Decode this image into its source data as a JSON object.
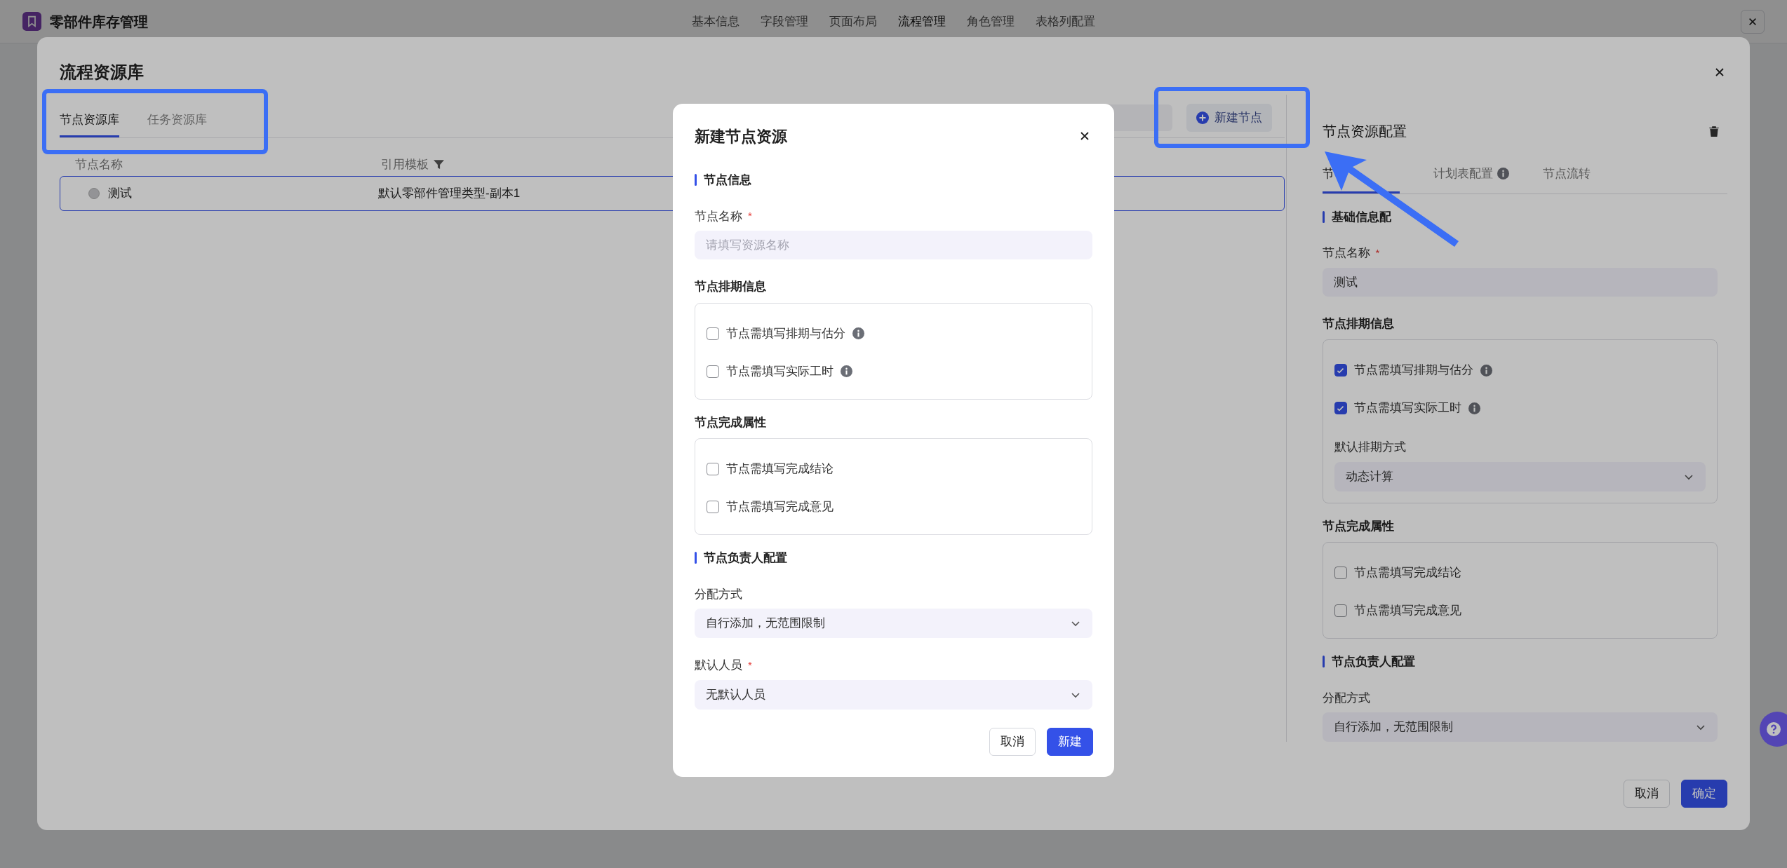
{
  "app": {
    "title": "零部件库存管理",
    "nav": [
      {
        "label": "基本信息",
        "selected": false
      },
      {
        "label": "字段管理",
        "selected": false
      },
      {
        "label": "页面布局",
        "selected": false
      },
      {
        "label": "流程管理",
        "selected": true
      },
      {
        "label": "角色管理",
        "selected": false
      },
      {
        "label": "表格列配置",
        "selected": false
      }
    ]
  },
  "library": {
    "title": "流程资源库",
    "tabs": [
      {
        "label": "节点资源库",
        "selected": true
      },
      {
        "label": "任务资源库",
        "selected": false
      }
    ],
    "new_button": "新建节点",
    "table": {
      "columns": [
        "节点名称",
        "引用模板"
      ],
      "rows": [
        {
          "name": "测试",
          "template": "默认零部件管理类型-副本1",
          "selected": true
        }
      ]
    },
    "buttons": [
      {
        "label": "取消",
        "kind": "secondary"
      },
      {
        "label": "确定",
        "kind": "primary"
      }
    ]
  },
  "config_panel": {
    "title": "节点资源配置",
    "tabs": [
      {
        "label": "节",
        "selected": true,
        "info": false
      },
      {
        "label": "计划表配置",
        "selected": false,
        "info": true
      },
      {
        "label": "节点流转",
        "selected": false,
        "info": false
      }
    ],
    "blocks": [
      {
        "kind": "section",
        "title": "基础信息配"
      },
      {
        "kind": "input",
        "label": "节点名称",
        "required_mark": "*",
        "value": "测试"
      },
      {
        "kind": "group",
        "title": "节点排期信息",
        "items": [
          {
            "kind": "checkbox",
            "label": "节点需填写排期与估分",
            "checked": true,
            "info": true
          },
          {
            "kind": "checkbox",
            "label": "节点需填写实际工时",
            "checked": true,
            "info": true
          },
          {
            "kind": "select",
            "label": "默认排期方式",
            "value": "动态计算"
          }
        ]
      },
      {
        "kind": "group",
        "title": "节点完成属性",
        "items": [
          {
            "kind": "checkbox",
            "label": "节点需填写完成结论",
            "checked": false,
            "info": false
          },
          {
            "kind": "checkbox",
            "label": "节点需填写完成意见",
            "checked": false,
            "info": false
          }
        ]
      },
      {
        "kind": "section",
        "title": "节点负责人配置"
      },
      {
        "kind": "select",
        "label": "分配方式",
        "value": "自行添加，无范围限制"
      }
    ]
  },
  "dialog": {
    "title": "新建节点资源",
    "blocks": [
      {
        "kind": "section",
        "title": "节点信息"
      },
      {
        "kind": "input",
        "label": "节点名称",
        "required_mark": "*",
        "placeholder": "请填写资源名称"
      },
      {
        "kind": "group",
        "title": "节点排期信息",
        "items": [
          {
            "kind": "checkbox",
            "label": "节点需填写排期与估分",
            "checked": false,
            "info": true
          },
          {
            "kind": "checkbox",
            "label": "节点需填写实际工时",
            "checked": false,
            "info": true
          }
        ]
      },
      {
        "kind": "group",
        "title": "节点完成属性",
        "items": [
          {
            "kind": "checkbox",
            "label": "节点需填写完成结论",
            "checked": false,
            "info": false
          },
          {
            "kind": "checkbox",
            "label": "节点需填写完成意见",
            "checked": false,
            "info": false
          }
        ]
      },
      {
        "kind": "section",
        "title": "节点负责人配置"
      },
      {
        "kind": "select",
        "label": "分配方式",
        "value": "自行添加，无范围限制"
      },
      {
        "kind": "select",
        "label": "默认人员",
        "required_mark": "*",
        "value": "无默认人员"
      }
    ],
    "buttons": [
      {
        "label": "取消",
        "kind": "secondary"
      },
      {
        "label": "新建",
        "kind": "primary"
      }
    ]
  }
}
